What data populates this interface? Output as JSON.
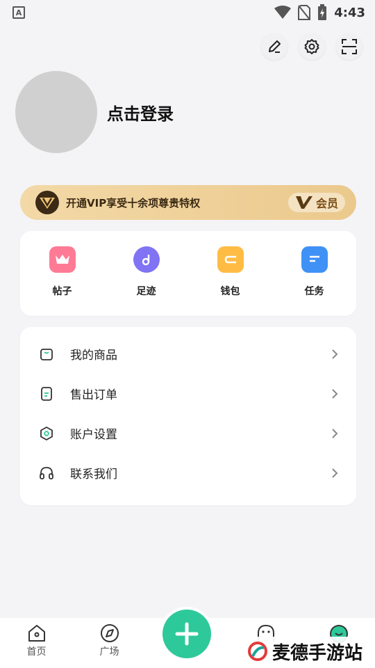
{
  "status_bar": {
    "time": "4:43",
    "left_badge": "A"
  },
  "profile": {
    "login_label": "点击登录"
  },
  "vip": {
    "text": "开通VIP享受十余项尊贵特权",
    "member_label": "会员"
  },
  "quick_actions": [
    {
      "label": "帖子",
      "icon": "crown-icon",
      "color": "#ff6a8a"
    },
    {
      "label": "足迹",
      "icon": "music-note-icon",
      "color": "#7a6af2"
    },
    {
      "label": "钱包",
      "icon": "wallet-icon",
      "color": "#ffb43a"
    },
    {
      "label": "任务",
      "icon": "task-list-icon",
      "color": "#3b8cf5"
    }
  ],
  "menu": [
    {
      "label": "我的商品",
      "icon": "bag-icon"
    },
    {
      "label": "售出订单",
      "icon": "order-icon"
    },
    {
      "label": "账户设置",
      "icon": "hexagon-settings-icon"
    },
    {
      "label": "联系我们",
      "icon": "headphones-icon"
    }
  ],
  "bottom_nav": {
    "home": "首页",
    "square": "广场"
  },
  "watermark": {
    "text": "麦德手游站"
  }
}
